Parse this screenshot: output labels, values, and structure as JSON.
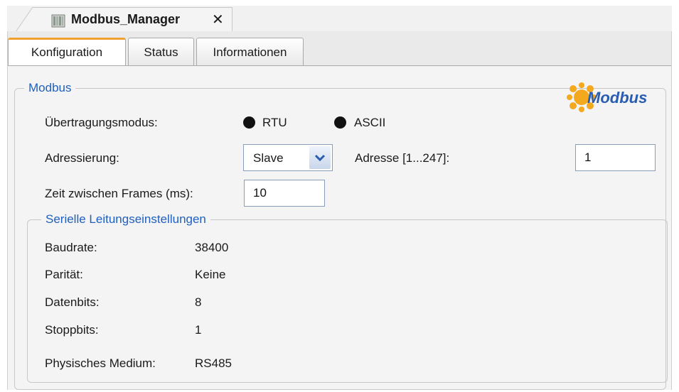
{
  "document_tab": {
    "title": "Modbus_Manager",
    "close_symbol": "✕"
  },
  "tabs": [
    {
      "label": "Konfiguration",
      "active": true
    },
    {
      "label": "Status",
      "active": false
    },
    {
      "label": "Informationen",
      "active": false
    }
  ],
  "modbus_group": {
    "legend": "Modbus",
    "transmission_mode_label": "Übertragungsmodus:",
    "mode_options": [
      "RTU",
      "ASCII"
    ],
    "addressing_label": "Adressierung:",
    "addressing_value": "Slave",
    "address_label": "Adresse [1...247]:",
    "address_value": "1",
    "frame_time_label": "Zeit zwischen Frames (ms):",
    "frame_time_value": "10",
    "logo_text": "Modbus"
  },
  "serial_group": {
    "legend": "Serielle Leitungseinstellungen",
    "rows": [
      {
        "label": "Baudrate:",
        "value": "38400"
      },
      {
        "label": "Parität:",
        "value": "Keine"
      },
      {
        "label": "Datenbits:",
        "value": "8"
      },
      {
        "label": "Stoppbits:",
        "value": "1"
      }
    ],
    "medium_label": "Physisches Medium:",
    "medium_value": "RS485"
  },
  "colors": {
    "accent_tab": "#f0a030",
    "legend_text": "#1f5fbf",
    "logo_blue": "#2a5db0",
    "logo_orange": "#f3a81e"
  },
  "icons": {
    "document_tab": "device-icon",
    "dropdown": "chevron-down-icon"
  }
}
